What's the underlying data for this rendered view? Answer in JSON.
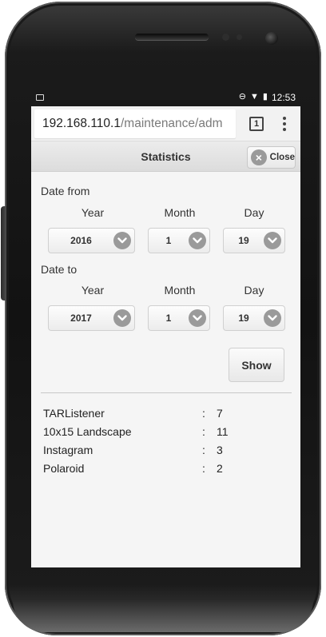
{
  "status_bar": {
    "time": "12:53"
  },
  "browser": {
    "url_host": "192.168.110.1",
    "url_path": "/maintenance/adm",
    "tab_count": "1"
  },
  "header": {
    "title": "Statistics",
    "close_label": "Close"
  },
  "date_from": {
    "label": "Date from",
    "year_label": "Year",
    "month_label": "Month",
    "day_label": "Day",
    "year": "2016",
    "month": "1",
    "day": "19"
  },
  "date_to": {
    "label": "Date to",
    "year_label": "Year",
    "month_label": "Month",
    "day_label": "Day",
    "year": "2017",
    "month": "1",
    "day": "19"
  },
  "show_label": "Show",
  "stats": [
    {
      "name": "TARListener",
      "sep": ":",
      "value": "7"
    },
    {
      "name": "10x15 Landscape",
      "sep": ":",
      "value": "11"
    },
    {
      "name": "Instagram",
      "sep": ":",
      "value": "3"
    },
    {
      "name": "Polaroid",
      "sep": ":",
      "value": "2"
    }
  ]
}
